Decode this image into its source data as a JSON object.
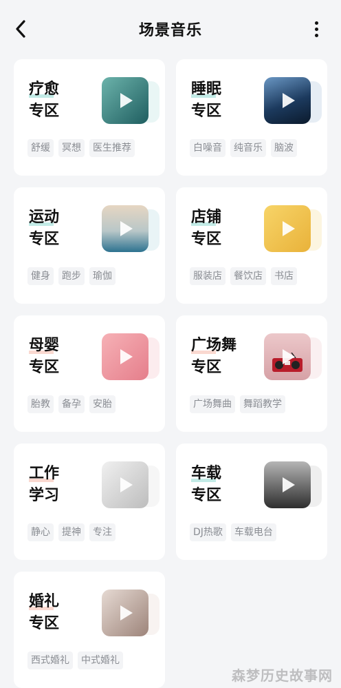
{
  "header": {
    "title": "场景音乐"
  },
  "cards": [
    {
      "line1": "疗愈",
      "line2": "专区",
      "tags": [
        "舒缓",
        "冥想",
        "医生推荐"
      ],
      "thumb_icon": "healing-icon",
      "thumb_colors": [
        "#5fa9a3",
        "#2a6f70"
      ],
      "accent": "#6cc7be"
    },
    {
      "line1": "睡眠",
      "line2": "专区",
      "tags": [
        "白噪音",
        "纯音乐",
        "脑波"
      ],
      "thumb_icon": "sleep-icon",
      "thumb_colors": [
        "#4b7cae",
        "#0f2540"
      ],
      "accent": "#6cc7be"
    },
    {
      "line1": "运动",
      "line2": "专区",
      "tags": [
        "健身",
        "跑步",
        "瑜伽"
      ],
      "thumb_icon": "sport-icon",
      "thumb_colors": [
        "#d8c9b8",
        "#2b6f8e"
      ],
      "accent": "#6cc7be"
    },
    {
      "line1": "店铺",
      "line2": "专区",
      "tags": [
        "服装店",
        "餐饮店",
        "书店"
      ],
      "thumb_icon": "shop-icon",
      "thumb_colors": [
        "#f5d063",
        "#e9b53a"
      ],
      "accent": "#f0c85a"
    },
    {
      "line1": "母婴",
      "line2": "专区",
      "tags": [
        "胎教",
        "备孕",
        "安胎"
      ],
      "thumb_icon": "baby-icon",
      "thumb_colors": [
        "#f4a7ad",
        "#e8858f"
      ],
      "accent": "#f2a39f"
    },
    {
      "line1": "广场舞",
      "line2": "专区",
      "tags": [
        "广场舞曲",
        "舞蹈教学"
      ],
      "thumb_icon": "radio-icon",
      "thumb_colors": [
        "#e8c6c8",
        "#d9a8ab"
      ],
      "accent": "#f2a39f"
    },
    {
      "line1": "工作",
      "line2": "学习",
      "tags": [
        "静心",
        "提神",
        "专注"
      ],
      "thumb_icon": "desk-lamp-icon",
      "thumb_colors": [
        "#e6e6e6",
        "#bfbfbf"
      ],
      "accent": "#f2a39f"
    },
    {
      "line1": "车载",
      "line2": "专区",
      "tags": [
        "DJ热歌",
        "车载电台"
      ],
      "thumb_icon": "car-icon",
      "thumb_colors": [
        "#9c9c9c",
        "#3a3a3a"
      ],
      "accent": "#6cc7be"
    },
    {
      "line1": "婚礼",
      "line2": "专区",
      "tags": [
        "西式婚礼",
        "中式婚礼"
      ],
      "thumb_icon": "wedding-icon",
      "thumb_colors": [
        "#e2d6cf",
        "#a88f86"
      ],
      "accent": "#f2a39f"
    }
  ],
  "watermark": "森梦历史故事网"
}
